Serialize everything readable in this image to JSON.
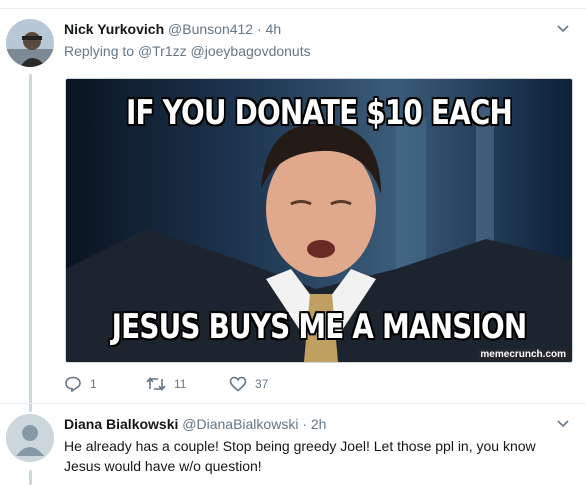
{
  "tweets": [
    {
      "name": "Nick Yurkovich",
      "handle": "@Bunson412",
      "time": "· 4h",
      "replying_label": "Replying to",
      "reply_mentions": [
        "@Tr1zz",
        "@joeybagovdonuts"
      ],
      "meme": {
        "top_text": "IF YOU DONATE $10 EACH",
        "bottom_text": "JESUS BUYS ME A MANSION",
        "watermark": "memecrunch.com"
      },
      "actions": {
        "replies": "1",
        "retweets": "11",
        "likes": "37"
      }
    },
    {
      "name": "Diana Bialkowski",
      "handle": "@DianaBialkowski",
      "time": "· 2h",
      "text": "He already has a couple! Stop being greedy Joel! Let those ppl in, you know Jesus would have w/o question!"
    }
  ],
  "icons": {
    "reply": "reply-icon",
    "retweet": "retweet-icon",
    "like": "heart-icon",
    "caret": "chevron-down-icon"
  },
  "colors": {
    "name": "#14171a",
    "secondary": "#657786",
    "thread_line": "#ccd6dd"
  }
}
